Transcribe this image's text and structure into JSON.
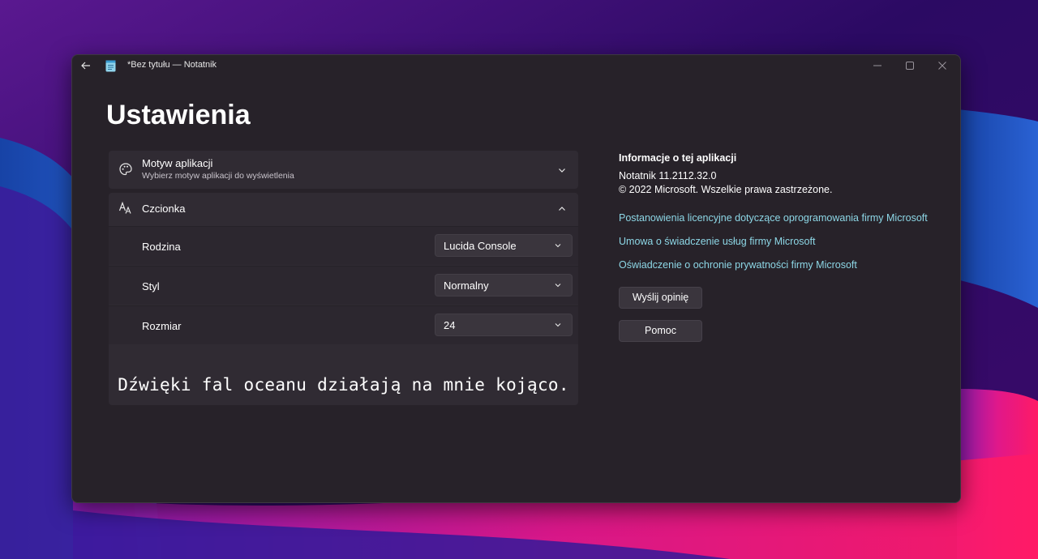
{
  "window": {
    "title": "*Bez tytułu — Notatnik"
  },
  "page": {
    "title": "Ustawienia"
  },
  "theme_setting": {
    "icon": "palette-icon",
    "title": "Motyw aplikacji",
    "description": "Wybierz motyw aplikacji do wyświetlenia"
  },
  "font_setting": {
    "icon": "font-icon",
    "title": "Czcionka",
    "family": {
      "label": "Rodzina",
      "value": "Lucida Console"
    },
    "style": {
      "label": "Styl",
      "value": "Normalny"
    },
    "size": {
      "label": "Rozmiar",
      "value": "24"
    },
    "preview": "Dźwięki fal oceanu działają na mnie kojąco."
  },
  "about": {
    "heading": "Informacje o tej aplikacji",
    "version": "Notatnik 11.2112.32.0",
    "copyright": "© 2022 Microsoft. Wszelkie prawa zastrzeżone.",
    "links": [
      "Postanowienia licencyjne dotyczące oprogramowania firmy Microsoft",
      "Umowa o świadczenie usług firmy Microsoft",
      "Oświadczenie o ochronie prywatności firmy Microsoft"
    ],
    "feedback_button": "Wyślij opinię",
    "help_button": "Pomoc"
  },
  "colors": {
    "window_bg": "#272229",
    "card_bg": "#302b33",
    "link": "#8dd7e6",
    "wallpaper_purple": "#3a0f6e",
    "wallpaper_blue": "#1e4fb0",
    "wallpaper_pink": "#f0157a"
  }
}
